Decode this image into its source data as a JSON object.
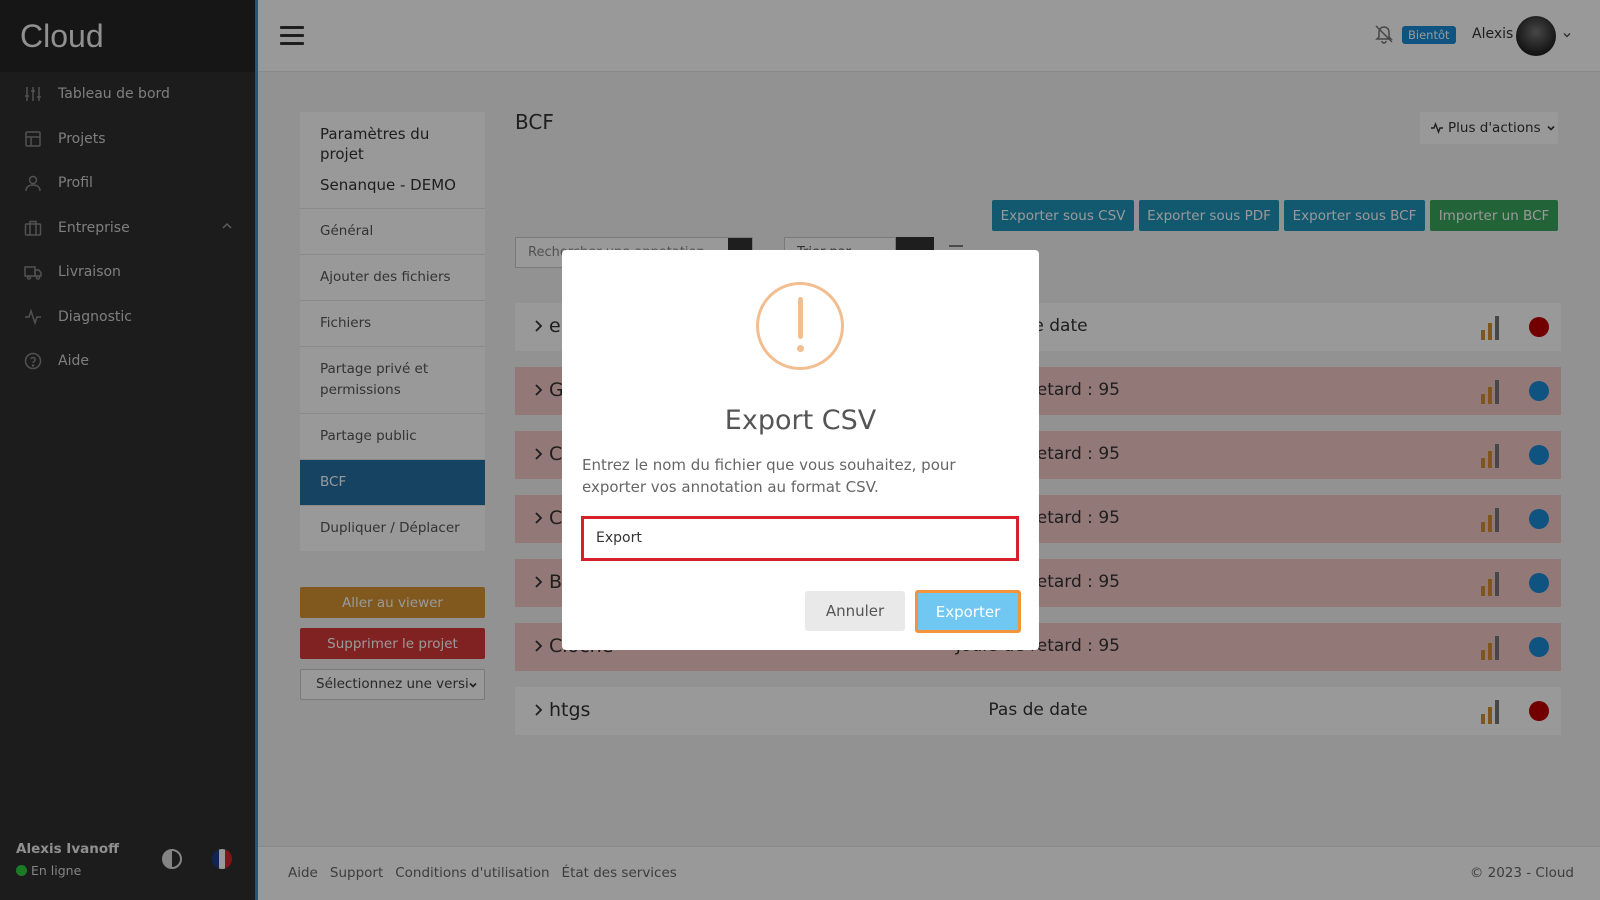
{
  "sidebar": {
    "brand": "Cloud",
    "items": [
      {
        "label": "Tableau de bord",
        "icon": "sliders-icon"
      },
      {
        "label": "Projets",
        "icon": "layout-icon"
      },
      {
        "label": "Profil",
        "icon": "user-icon"
      },
      {
        "label": "Entreprise",
        "icon": "briefcase-icon"
      },
      {
        "label": "Livraison",
        "icon": "truck-icon"
      },
      {
        "label": "Diagnostic",
        "icon": "activity-icon"
      },
      {
        "label": "Aide",
        "icon": "help-circle-icon"
      }
    ],
    "user_name": "Alexis Ivanoff",
    "status": "En ligne"
  },
  "topbar": {
    "badge": "Bientôt",
    "user": "Alexis"
  },
  "settings": {
    "heading": "Paramètres du projet",
    "project": "Senanque - DEMO",
    "items": [
      "Général",
      "Ajouter des fichiers",
      "Fichiers",
      "Partage privé et permissions",
      "Partage public",
      "BCF",
      "Dupliquer / Déplacer"
    ],
    "active_index": 5,
    "viewer_button": "Aller au viewer",
    "delete_button": "Supprimer le projet",
    "version_select": "Sélectionnez une versi"
  },
  "main": {
    "title": "BCF",
    "more_actions": "Plus d'actions",
    "export_buttons": [
      "Exporter sous CSV",
      "Exporter sous PDF",
      "Exporter sous BCF"
    ],
    "import_button": "Importer un BCF",
    "search_placeholder": "Rechercher une annotation",
    "sort_label": "Trier par",
    "rows": [
      {
        "name": "e",
        "date": "Pas de date",
        "late": false,
        "status_color": "#c00000"
      },
      {
        "name": "G",
        "date": "Jours de retard : 95",
        "late": true,
        "status_color": "#1a8cd8"
      },
      {
        "name": "C",
        "date": "Jours de retard : 95",
        "late": true,
        "status_color": "#1a8cd8"
      },
      {
        "name": "C",
        "date": "Jours de retard : 95",
        "late": true,
        "status_color": "#1a8cd8"
      },
      {
        "name": "B",
        "date": "Jours de retard : 95",
        "late": true,
        "status_color": "#1a8cd8"
      },
      {
        "name": "Cloche",
        "date": "Jours de retard : 95",
        "late": true,
        "status_color": "#1a8cd8"
      },
      {
        "name": "htgs",
        "date": "Pas de date",
        "late": false,
        "status_color": "#c00000"
      }
    ]
  },
  "footer": {
    "links": [
      "Aide",
      "Support",
      "Conditions d'utilisation",
      "État des services"
    ],
    "copyright": "© 2023 - Cloud"
  },
  "modal": {
    "title": "Export CSV",
    "text": "Entrez le nom du fichier que vous souhaitez, pour exporter vos annotation au format CSV.",
    "input_value": "Export",
    "cancel": "Annuler",
    "confirm": "Exporter"
  },
  "colors": {
    "accent": "#2770a3",
    "danger": "#d83a3a",
    "warning": "#d89433",
    "export_blue": "#1f93b8",
    "import_green": "#3aa55c"
  }
}
